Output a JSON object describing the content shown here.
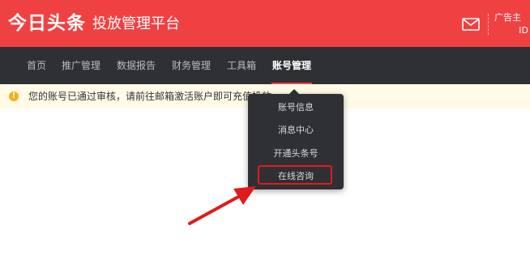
{
  "header": {
    "logo": "今日头条",
    "platform_title": "投放管理平台",
    "account_line1": "广告主",
    "account_line2": "ID"
  },
  "nav": {
    "items": [
      "首页",
      "推广管理",
      "数据报告",
      "财务管理",
      "工具箱",
      "账号管理"
    ],
    "active_index": 5
  },
  "notice": {
    "text": "您的账号已通过审核，请前往邮箱激活账户即可充值投放"
  },
  "dropdown": {
    "items": [
      "账号信息",
      "消息中心",
      "开通头条号",
      "在线咨询"
    ],
    "highlighted_index": 3
  },
  "colors": {
    "brand_red": "#f04142",
    "nav_bg": "#2e3034",
    "dropdown_bg": "#2f3033",
    "notice_bg": "#fffbe6",
    "annotation_red": "#e01b1b"
  },
  "icons": {
    "mail": "mail-icon",
    "warning": "warning-icon",
    "annotation": "red-arrow-icon"
  }
}
